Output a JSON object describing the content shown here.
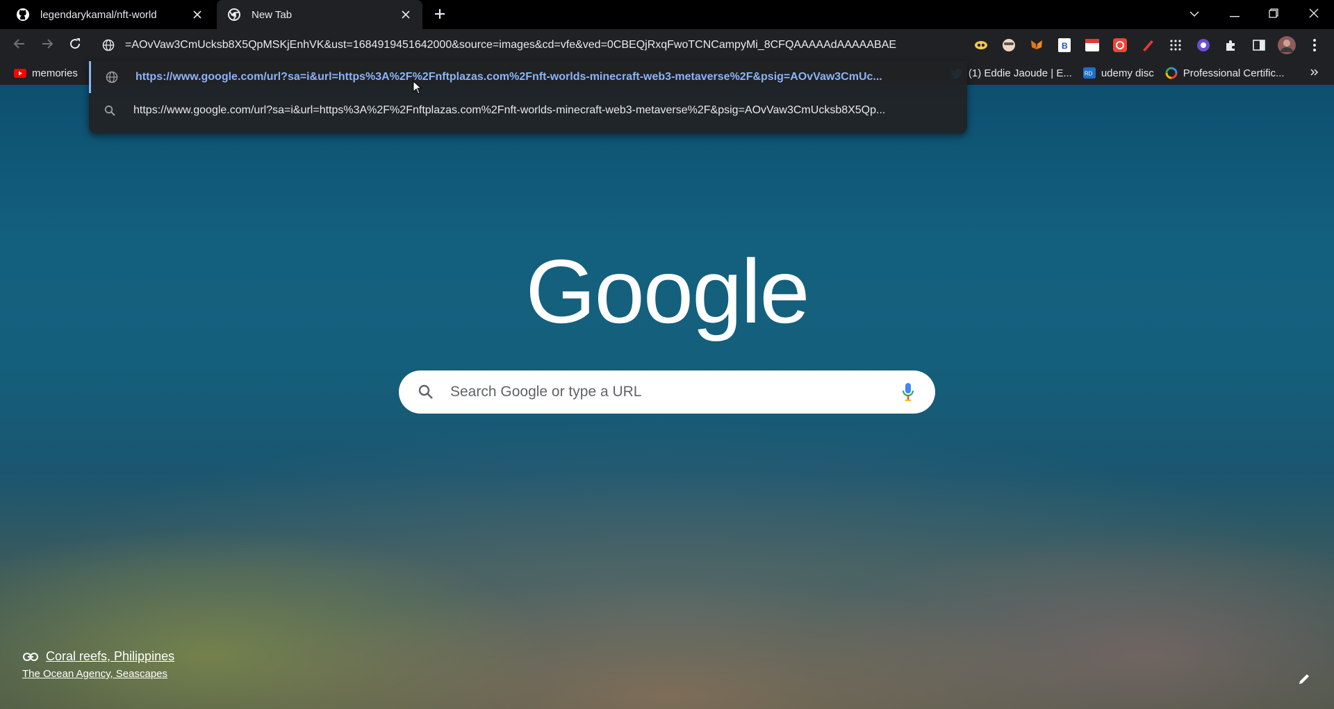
{
  "tabs": [
    {
      "title": "legendarykamal/nft-world",
      "icon": "github-icon",
      "active": false
    },
    {
      "title": "New Tab",
      "icon": "chrome-icon",
      "active": true
    }
  ],
  "omnibox": {
    "value": "=AOvVaw3CmUcksb8X5QpMSKjEnhVK&ust=1684919451642000&source=images&cd=vfe&ved=0CBEQjRxqFwoTCNCampyMi_8CFQAAAAAdAAAAABAE",
    "site_icon": "globe-icon"
  },
  "suggestions": [
    {
      "text": "https://www.google.com/url?sa=i&url=https%3A%2F%2Fnftplazas.com%2Fnft-worlds-minecraft-web3-metaverse%2F&psig=AOvVaw3CmUc...",
      "icon": "globe-icon"
    },
    {
      "text": "https://www.google.com/url?sa=i&url=https%3A%2F%2Fnftplazas.com%2Fnft-worlds-minecraft-web3-metaverse%2F&psig=AOvVaw3CmUcksb8X5Qp...",
      "icon": "search-icon"
    }
  ],
  "bookmarks": [
    {
      "label": "memories",
      "icon": "youtube-icon"
    },
    {
      "label": "(1) Eddie Jaoude | E...",
      "icon": "twitter-icon"
    },
    {
      "label": "udemy disc",
      "icon": "rd-icon"
    },
    {
      "label": "Professional Certific...",
      "icon": "google-icon"
    }
  ],
  "extensions": [
    "eye-ext-icon",
    "face-ext-icon",
    "metamask-icon",
    "b-ext-icon",
    "calendar-ext-icon",
    "record-ext-icon",
    "pen-ext-icon",
    "grid-ext-icon",
    "circle-ext-icon",
    "puzzle-icon",
    "sidepanel-icon",
    "profile-avatar"
  ],
  "ntp": {
    "logo": "Google",
    "search_placeholder": "Search Google or type a URL",
    "attribution_title": "Coral reefs, Philippines",
    "attribution_sub": "The Ocean Agency, Seascapes"
  },
  "colors": {
    "accent": "#8ab4f8",
    "chrome_dark": "#202124",
    "tabstrip": "#000000"
  }
}
